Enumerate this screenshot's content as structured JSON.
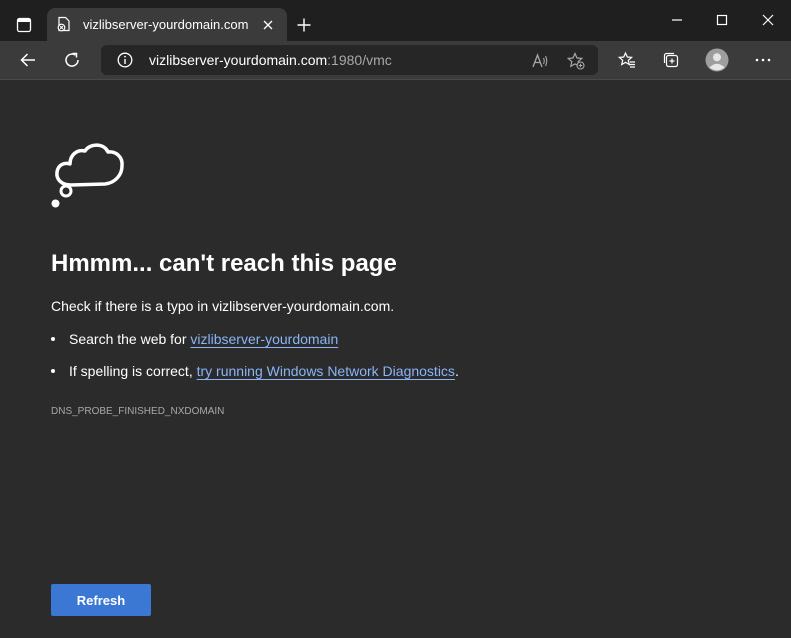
{
  "tab": {
    "title": "vizlibserver-yourdomain.com",
    "favicon_icon": "error-page-icon",
    "close_icon": "close-icon"
  },
  "window": {
    "minimize_icon": "minimize-icon",
    "maximize_icon": "maximize-icon",
    "close_icon": "close-icon"
  },
  "address": {
    "host": "vizlibserver-yourdomain.com",
    "path": ":1980/vmc"
  },
  "error": {
    "heading": "Hmmm... can't reach this page",
    "check_text": "Check if there is a typo in vizlibserver-yourdomain.com.",
    "search_prefix": "Search the web for ",
    "search_link": "vizlibserver-yourdomain",
    "spelling_prefix": "If spelling is correct, ",
    "diagnostics_link": "try running Windows Network Diagnostics",
    "spelling_suffix": ".",
    "code": "DNS_PROBE_FINISHED_NXDOMAIN",
    "refresh_label": "Refresh"
  },
  "colors": {
    "link": "#8ab4f8",
    "button": "#3a78d4",
    "page_bg": "#2b2b2b"
  }
}
